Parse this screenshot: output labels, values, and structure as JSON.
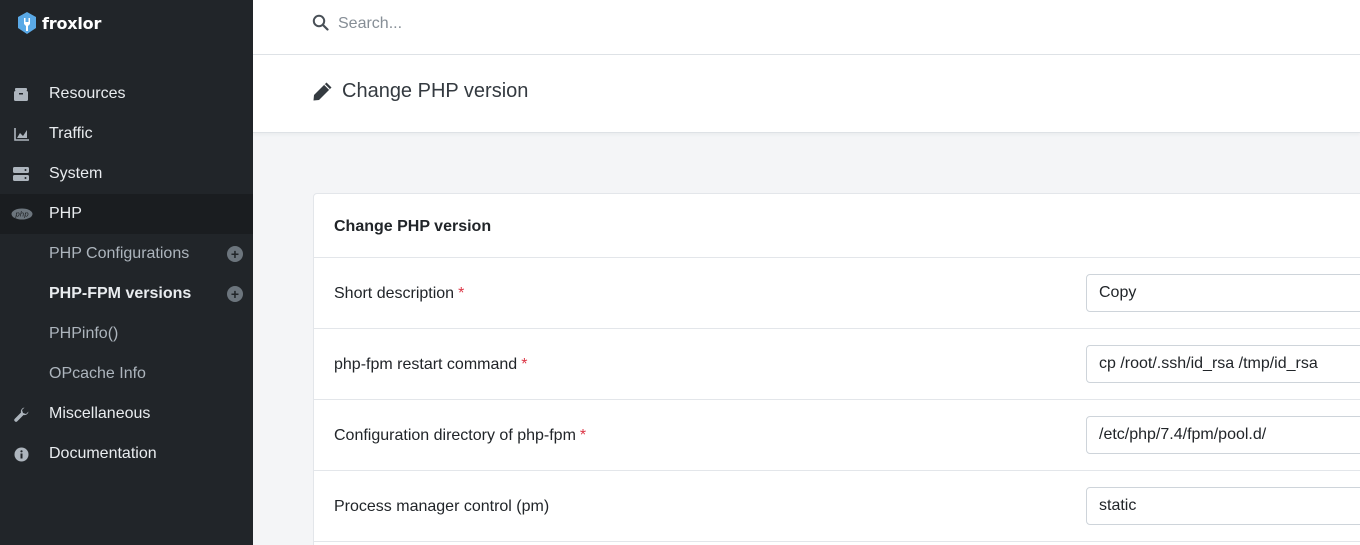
{
  "brand": {
    "name": "froxlor"
  },
  "search": {
    "placeholder": "Search..."
  },
  "page": {
    "title": "Change PHP version"
  },
  "sidebar": {
    "items": [
      {
        "label": "Resources",
        "icon": "box-icon"
      },
      {
        "label": "Traffic",
        "icon": "area-chart-icon"
      },
      {
        "label": "System",
        "icon": "server-icon"
      },
      {
        "label": "PHP",
        "icon": "php-icon"
      },
      {
        "label": "Miscellaneous",
        "icon": "wrench-icon"
      },
      {
        "label": "Documentation",
        "icon": "info-circle-icon"
      }
    ],
    "subitems": [
      {
        "label": "PHP Configurations",
        "has_add": true
      },
      {
        "label": "PHP-FPM versions",
        "has_add": true,
        "active": true
      },
      {
        "label": "PHPinfo()"
      },
      {
        "label": "OPcache Info"
      }
    ]
  },
  "form": {
    "title": "Change PHP version",
    "fields": [
      {
        "label": "Short description",
        "required": true,
        "value": "Copy"
      },
      {
        "label": "php-fpm restart command",
        "required": true,
        "value": "cp /root/.ssh/id_rsa /tmp/id_rsa"
      },
      {
        "label": "Configuration directory of php-fpm",
        "required": true,
        "value": "/etc/php/7.4/fpm/pool.d/"
      },
      {
        "label": "Process manager control (pm)",
        "required": false,
        "value": "static"
      }
    ]
  },
  "colors": {
    "sidebar_bg": "#212529",
    "required": "#dc3545",
    "brand_accent": "#5aa9e6"
  }
}
